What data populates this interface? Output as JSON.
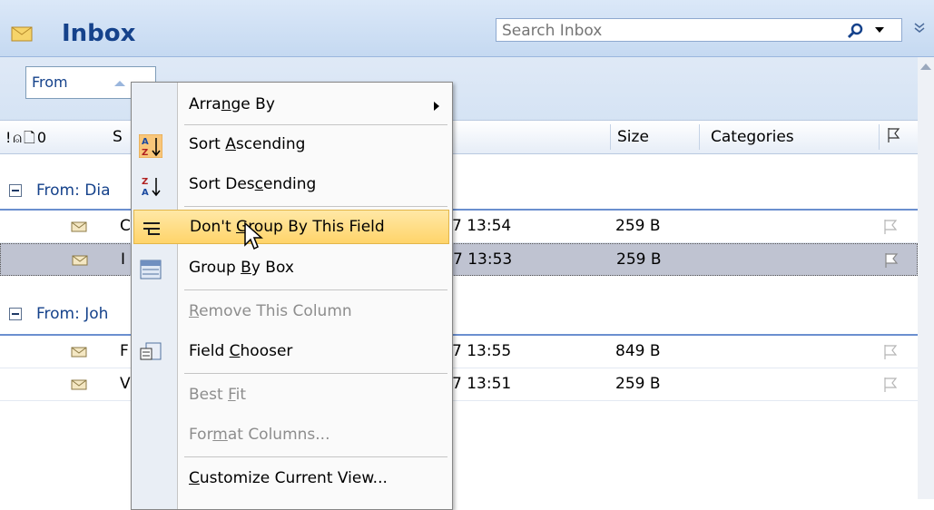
{
  "header": {
    "title": "Inbox",
    "search_placeholder": "Search Inbox"
  },
  "groupby": {
    "field": "From"
  },
  "columns": {
    "size": "Size",
    "categories": "Categories",
    "subject_partial": "S"
  },
  "groups": [
    {
      "label": "From: Dia",
      "rows": [
        {
          "subject": "C",
          "received": "7 13:54",
          "size": "259 B",
          "selected": false
        },
        {
          "subject": "I",
          "received": "7 13:53",
          "size": "259 B",
          "selected": true
        }
      ]
    },
    {
      "label": "From: Joh",
      "rows": [
        {
          "subject": "F",
          "received": "7 13:55",
          "size": "849 B",
          "selected": false
        },
        {
          "subject": "V",
          "received": "7 13:51",
          "size": "259 B",
          "selected": false
        }
      ]
    }
  ],
  "context_menu": {
    "items": [
      {
        "pre": "Arra",
        "u": "n",
        "post": "ge By",
        "enabled": true,
        "submenu": true,
        "icon": ""
      },
      {
        "pre": "Sort ",
        "u": "A",
        "post": "scending",
        "enabled": true,
        "icon": "sort-ascending-icon"
      },
      {
        "pre": "Sort Des",
        "u": "c",
        "post": "ending",
        "enabled": true,
        "icon": "sort-descending-icon"
      },
      {
        "pre": "Don't ",
        "u": "G",
        "post": "roup By This Field",
        "enabled": true,
        "highlighted": true,
        "icon": "ungroup-icon"
      },
      {
        "pre": "Group ",
        "u": "B",
        "post": "y Box",
        "enabled": true,
        "icon": "group-box-icon"
      },
      {
        "pre": "",
        "u": "R",
        "post": "emove This Column",
        "enabled": false,
        "icon": ""
      },
      {
        "pre": "Field ",
        "u": "C",
        "post": "hooser",
        "enabled": true,
        "icon": "field-chooser-icon"
      },
      {
        "pre": "Best ",
        "u": "F",
        "post": "it",
        "enabled": false,
        "icon": ""
      },
      {
        "pre": "For",
        "u": "m",
        "post": "at Columns...",
        "enabled": false,
        "icon": ""
      },
      {
        "pre": "",
        "u": "C",
        "post": "ustomize Current View...",
        "enabled": true,
        "icon": ""
      }
    ]
  },
  "colors": {
    "title": "#15428b",
    "highlight": "#ffd46a",
    "selected_row": "#bfc3d1"
  }
}
